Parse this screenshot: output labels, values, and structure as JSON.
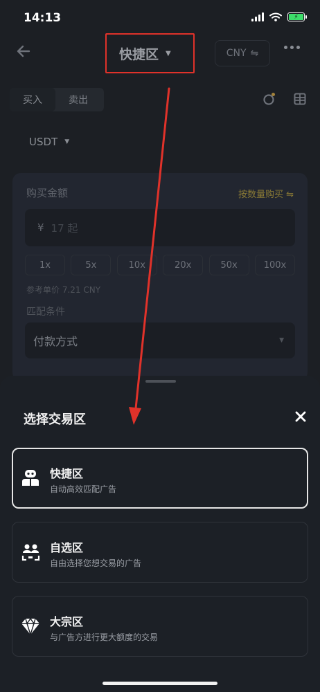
{
  "status_bar": {
    "time": "14:13"
  },
  "nav": {
    "title": "快捷区",
    "currency": "CNY",
    "currency_icon": "⇋"
  },
  "trade_tabs": [
    {
      "label": "买入"
    },
    {
      "label": "卖出"
    }
  ],
  "coin": {
    "selected": "USDT"
  },
  "buy_form": {
    "amount_label": "购买金额",
    "by_quantity_label": "按数量购买 ⇋",
    "currency_symbol": "¥",
    "amount_placeholder": "17 起",
    "multipliers": [
      "1x",
      "5x",
      "10x",
      "20x",
      "50x",
      "100x"
    ],
    "reference_price": "参考单价 7.21 CNY",
    "match_label": "匹配条件",
    "payment_method_label": "付款方式"
  },
  "sheet": {
    "title": "选择交易区",
    "options": [
      {
        "title": "快捷区",
        "desc": "自动高效匹配广告",
        "icon": "robot-icon",
        "selected": true
      },
      {
        "title": "自选区",
        "desc": "自由选择您想交易的广告",
        "icon": "users-select-icon",
        "selected": false
      },
      {
        "title": "大宗区",
        "desc": "与广告方进行更大额度的交易",
        "icon": "diamond-icon",
        "selected": false
      }
    ]
  },
  "colors": {
    "annotation_red": "#e0322a",
    "accent_gold": "#8a7a35",
    "battery_green": "#3ddc6a"
  }
}
